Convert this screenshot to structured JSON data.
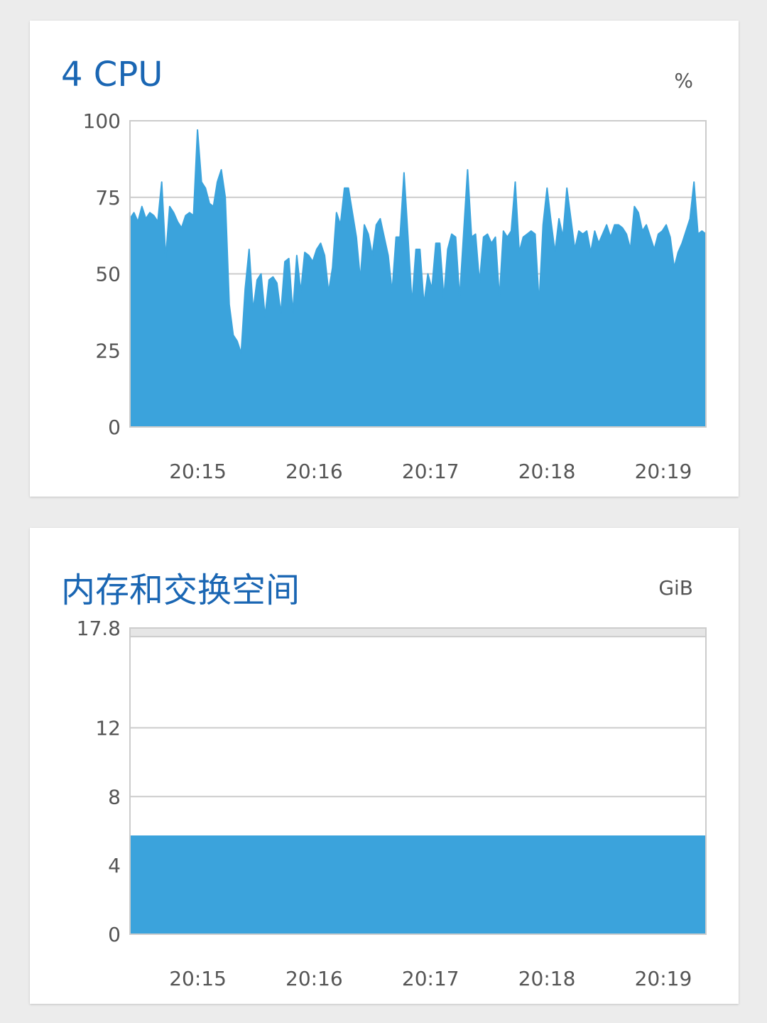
{
  "colors": {
    "accent": "#1a66b3",
    "fill": "#3ba3dc",
    "grid": "#cccccc",
    "text": "#555555"
  },
  "cpu": {
    "title": "4 CPU",
    "unit": "%"
  },
  "memory": {
    "title": "内存和交换空间",
    "unit": "GiB"
  },
  "chart_data": [
    {
      "type": "area",
      "title": "4 CPU",
      "ylabel": "%",
      "ylim": [
        0,
        100
      ],
      "yticks": [
        "100",
        "75",
        "50",
        "25",
        "0"
      ],
      "xticks": [
        "20:15",
        "20:16",
        "20:17",
        "20:18",
        "20:19"
      ],
      "x_range": [
        "20:14:25",
        "20:19:22"
      ],
      "values": [
        68,
        70,
        67,
        72,
        68,
        70,
        69,
        67,
        80,
        55,
        72,
        70,
        67,
        65,
        69,
        70,
        69,
        97,
        80,
        78,
        73,
        72,
        80,
        84,
        75,
        40,
        30,
        28,
        24,
        45,
        58,
        38,
        48,
        50,
        36,
        48,
        49,
        47,
        37,
        54,
        55,
        37,
        56,
        44,
        57,
        56,
        54,
        58,
        60,
        56,
        44,
        52,
        70,
        66,
        78,
        78,
        70,
        62,
        48,
        66,
        63,
        56,
        66,
        68,
        62,
        56,
        44,
        62,
        62,
        83,
        62,
        40,
        58,
        58,
        40,
        50,
        45,
        60,
        60,
        42,
        58,
        63,
        62,
        42,
        63,
        84,
        62,
        63,
        47,
        62,
        63,
        60,
        62,
        42,
        64,
        62,
        64,
        80,
        57,
        62,
        63,
        64,
        63,
        40,
        66,
        78,
        67,
        57,
        68,
        62,
        78,
        68,
        58,
        64,
        63,
        64,
        57,
        64,
        60,
        63,
        66,
        62,
        66,
        66,
        65,
        63,
        58,
        72,
        70,
        64,
        66,
        62,
        58,
        63,
        64,
        66,
        62,
        52,
        57,
        60,
        64,
        68,
        80,
        63,
        64,
        63
      ],
      "grid": true
    },
    {
      "type": "area",
      "title": "内存和交换空间",
      "ylabel": "GiB",
      "ylim": [
        0,
        17.8
      ],
      "yticks": [
        "17.8",
        "12",
        "8",
        "4",
        "0"
      ],
      "xticks": [
        "20:15",
        "20:16",
        "20:17",
        "20:18",
        "20:19"
      ],
      "x_range": [
        "20:14:25",
        "20:19:22"
      ],
      "values": [
        5.7,
        5.7,
        5.7,
        5.7,
        5.7,
        5.7,
        5.7,
        5.7,
        5.7,
        5.7,
        5.7
      ],
      "limit": 17.3,
      "grid": true
    }
  ]
}
